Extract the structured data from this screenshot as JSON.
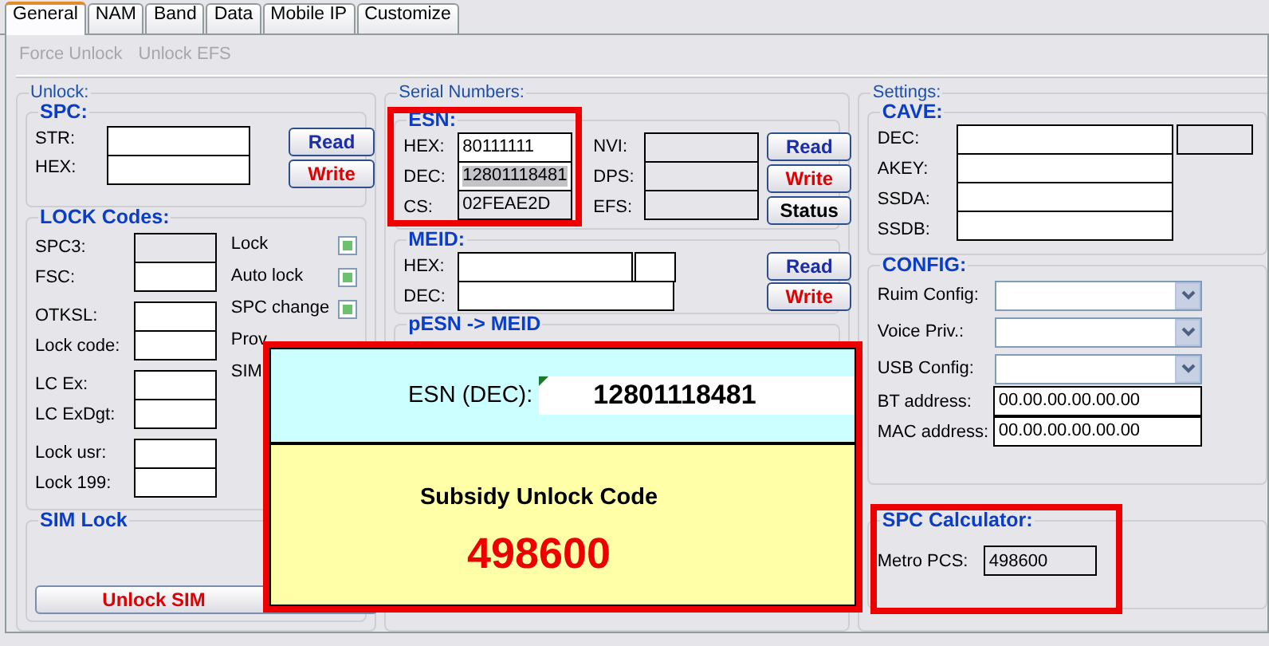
{
  "tabs": [
    {
      "label": "General",
      "selected": true
    },
    {
      "label": "NAM",
      "selected": false
    },
    {
      "label": "Band",
      "selected": false
    },
    {
      "label": "Data",
      "selected": false
    },
    {
      "label": "Mobile IP",
      "selected": false
    },
    {
      "label": "Customize",
      "selected": false
    }
  ],
  "toolbar": [
    {
      "label": "Force Unlock",
      "disabled": true
    },
    {
      "label": "Unlock EFS",
      "disabled": true
    }
  ],
  "unlock": {
    "title": "Unlock:",
    "spc": {
      "title": "SPC:",
      "fields": [
        {
          "label": "STR:"
        },
        {
          "label": "HEX:"
        }
      ],
      "buttons": [
        {
          "label": "Read",
          "kind": "read"
        },
        {
          "label": "Write",
          "kind": "write"
        }
      ]
    },
    "lock_codes": {
      "title": "LOCK Codes:",
      "groups": [
        [
          {
            "label": "SPC3:",
            "disabled": true
          },
          {
            "label": "FSC:",
            "disabled": false
          }
        ],
        [
          {
            "label": "OTKSL:",
            "disabled": false
          },
          {
            "label": "Lock code:",
            "disabled": false
          }
        ],
        [
          {
            "label": "LC Ex:",
            "disabled": false
          },
          {
            "label": "LC ExDgt:",
            "disabled": false
          }
        ],
        [
          {
            "label": "Lock usr:",
            "disabled": false
          },
          {
            "label": "Lock 199:",
            "disabled": false
          }
        ]
      ],
      "checks": [
        {
          "label": "Lock",
          "checked": true
        },
        {
          "label": "Auto lock",
          "checked": true
        },
        {
          "label": "SPC change",
          "checked": true
        },
        {
          "label": "Prov"
        },
        {
          "label": "SIM"
        }
      ]
    },
    "sim_lock": {
      "title": "SIM Lock",
      "button": "Unlock SIM"
    }
  },
  "serial": {
    "title": "Serial Numbers:",
    "esn": {
      "title": "ESN:",
      "fields": [
        {
          "label": "HEX:",
          "value": "80111111",
          "kind": "normal"
        },
        {
          "label": "DEC:",
          "value": "12801118481",
          "kind": "selected"
        },
        {
          "label": "CS:",
          "value": "02FEAE2D",
          "kind": "readonly"
        }
      ],
      "status_fields": [
        {
          "label": "NVI:"
        },
        {
          "label": "DPS:"
        },
        {
          "label": "EFS:"
        }
      ],
      "buttons": [
        {
          "label": "Read",
          "kind": "read"
        },
        {
          "label": "Write",
          "kind": "write"
        },
        {
          "label": "Status",
          "kind": "plain"
        }
      ]
    },
    "meid": {
      "title": "MEID:",
      "fields": [
        {
          "label": "HEX:"
        },
        {
          "label": "DEC:"
        }
      ],
      "buttons": [
        {
          "label": "Read",
          "kind": "read"
        },
        {
          "label": "Write",
          "kind": "write"
        }
      ]
    },
    "pesn": {
      "title": "pESN -> MEID"
    }
  },
  "settings": {
    "title": "Settings:",
    "cave": {
      "title": "CAVE:",
      "fields": [
        {
          "label": "DEC:"
        },
        {
          "label": "AKEY:"
        },
        {
          "label": "SSDA:"
        },
        {
          "label": "SSDB:"
        }
      ]
    },
    "config": {
      "title": "CONFIG:",
      "rows": [
        {
          "label": "Ruim Config:",
          "kind": "select"
        },
        {
          "label": "Voice Priv.:",
          "kind": "select"
        },
        {
          "label": "USB Config:",
          "kind": "select"
        },
        {
          "label": "BT address:",
          "kind": "text",
          "value": "00.00.00.00.00.00"
        },
        {
          "label": "MAC address:",
          "kind": "text",
          "value": "00.00.00.00.00.00"
        }
      ]
    },
    "spc_calculator": {
      "title": "SPC Calculator:",
      "label": "Metro PCS:",
      "value": "498600"
    }
  },
  "popup": {
    "esn_label": "ESN (DEC):",
    "esn_value": "12801118481",
    "title": "Subsidy Unlock Code",
    "code": "498600"
  }
}
